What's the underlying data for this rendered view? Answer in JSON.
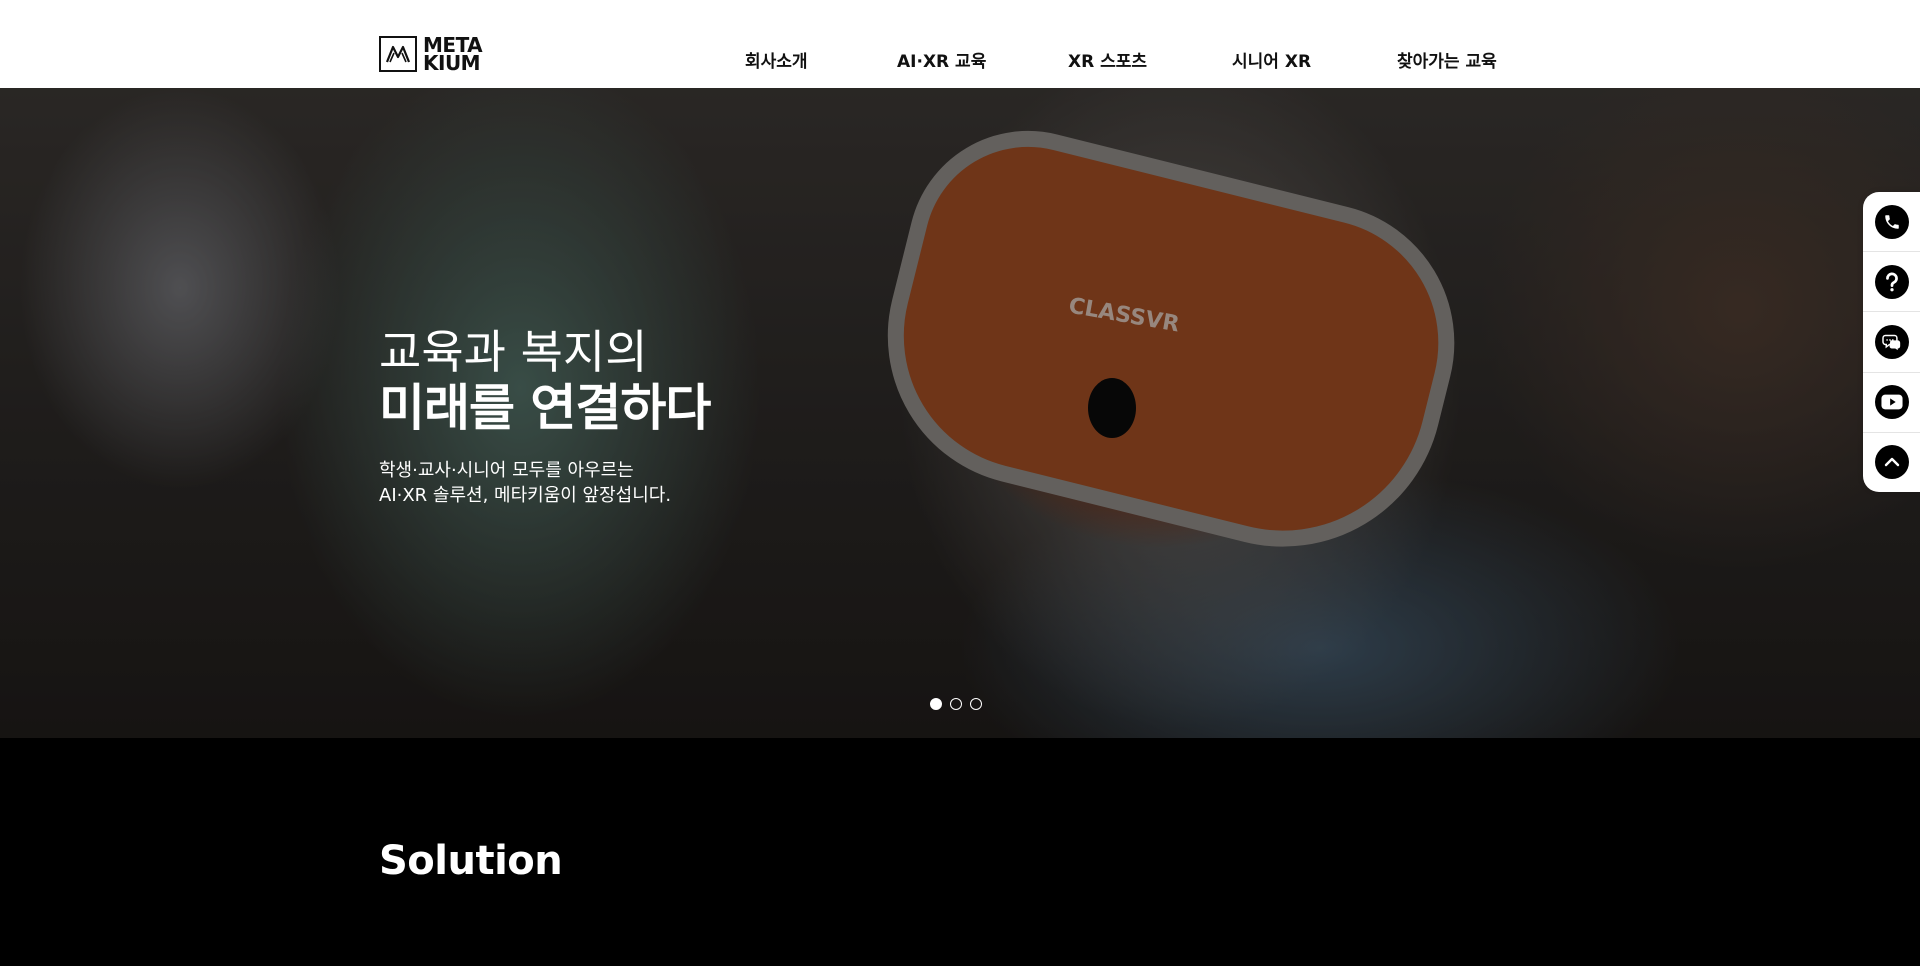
{
  "header": {
    "logo": {
      "line1": "META",
      "line2": "KIUM"
    },
    "nav": [
      {
        "label": "회사소개"
      },
      {
        "label": "AI·XR 교육"
      },
      {
        "label": "XR 스포츠"
      },
      {
        "label": "시니어 XR"
      },
      {
        "label": "찾아가는 교육"
      }
    ]
  },
  "hero": {
    "title_light": "교육과 복지의",
    "title_bold": "미래를 연결하다",
    "desc_line1": "학생·교사·시니어 모두를 아우르는",
    "desc_line2": "AI·XR 솔루션, 메타키움이 앞장섭니다.",
    "image_brand_text": "CLASSVR",
    "slides_total": 3,
    "active_slide": 1
  },
  "sidebar": {
    "buttons": [
      {
        "icon": "phone-icon"
      },
      {
        "icon": "question-icon"
      },
      {
        "icon": "chat-icon"
      },
      {
        "icon": "youtube-icon"
      },
      {
        "icon": "chevron-up-icon"
      }
    ]
  },
  "solution": {
    "title": "Solution"
  },
  "colors": {
    "header_bg": "#ffffff",
    "text_dark": "#111111",
    "section_bg": "#000000"
  }
}
